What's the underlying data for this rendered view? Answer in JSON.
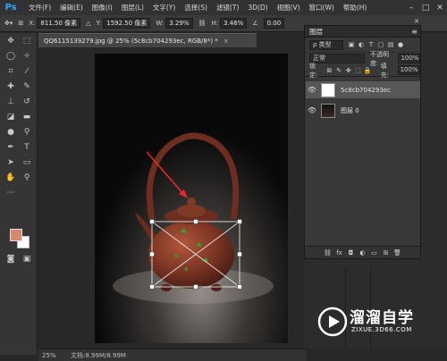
{
  "app": {
    "logo": "Ps"
  },
  "menu": [
    "文件(F)",
    "编辑(E)",
    "图像(I)",
    "图层(L)",
    "文字(Y)",
    "选择(S)",
    "滤镜(T)",
    "3D(D)",
    "视图(V)",
    "窗口(W)",
    "帮助(H)"
  ],
  "window_controls": {
    "minimize": "–",
    "maximize": "□",
    "close": "✕"
  },
  "options": {
    "x_label": "X:",
    "x_value": "811.50 像素",
    "y_label": "Y:",
    "y_value": "1592.50 像素",
    "w_label": "W:",
    "w_value": "3.29%",
    "h_label": "H:",
    "h_value": "3.46%",
    "angle_value": "0.00"
  },
  "document_tab": {
    "title": "QQ6115139279.jpg @ 25% (5c8cb704293ec, RGB/8*) *",
    "close": "×"
  },
  "status": {
    "zoom": "25%",
    "doc_info": "文档:8.99M/8.99M"
  },
  "layers_panel": {
    "title": "图层",
    "menu_icon": "≡",
    "close": "✕",
    "filter_kind": "ρ 类型",
    "blend_mode": "正常",
    "opacity_label": "不透明度:",
    "opacity_value": "100%",
    "lock_label": "锁定:",
    "fill_label": "填充:",
    "fill_value": "100%",
    "layers": [
      {
        "name": "5c8cb704293ec",
        "selected": true
      },
      {
        "name": "图层 0",
        "selected": false
      }
    ]
  },
  "watermark": {
    "title": "溜溜自学",
    "url": "ZIXUE.3D66.COM"
  },
  "colors": {
    "foreground": "#d58a6d",
    "background": "#ffffff",
    "accent": "#31a8ff"
  }
}
